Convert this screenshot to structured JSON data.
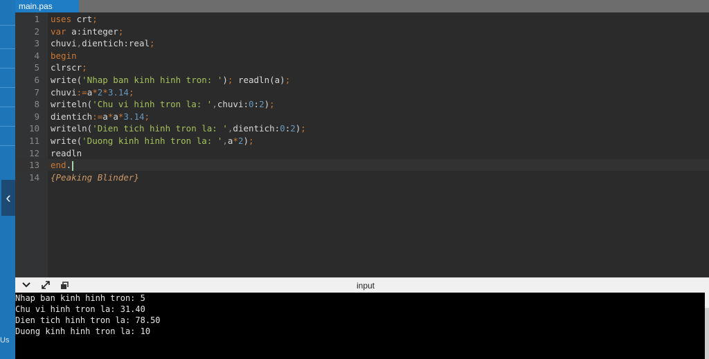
{
  "tab": {
    "label": "main.pas"
  },
  "sidebar": {
    "collapse_glyph": "‹",
    "label": "Us"
  },
  "code_lines": [
    "uses crt;",
    "var a:integer;",
    "chuvi,dientich:real;",
    "begin",
    "clrscr;",
    "write('Nhap ban kinh hinh tron: '); readln(a);",
    "chuvi:=a*2*3.14;",
    "writeln('Chu vi hinh tron la: ',chuvi:0:2);",
    "dientich:=a*a*3.14;",
    "writeln('Dien tich hinh tron la: ',dientich:0:2);",
    "write('Duong kinh hinh tron la: ',a*2);",
    "readln",
    "end.",
    "{Peaking Blinder}"
  ],
  "line_numbers": [
    "1",
    "2",
    "3",
    "4",
    "5",
    "6",
    "7",
    "8",
    "9",
    "10",
    "11",
    "12",
    "13",
    "14"
  ],
  "output_panel": {
    "title": "input",
    "icons": [
      "chevron-down-icon",
      "expand-icon",
      "run-icon"
    ],
    "lines": [
      "Nhap ban kinh hinh tron: 5",
      "Chu vi hinh tron la: 31.40",
      "Dien tich hinh tron la: 78.50",
      "Duong kinh hinh tron la: 10"
    ]
  },
  "colors": {
    "keyword": "#cc7832",
    "string": "#a5c25c",
    "number": "#6897bb",
    "comment": "#cc9966",
    "tab_active": "#1f7dc6",
    "side_strip": "#1e75b8"
  }
}
